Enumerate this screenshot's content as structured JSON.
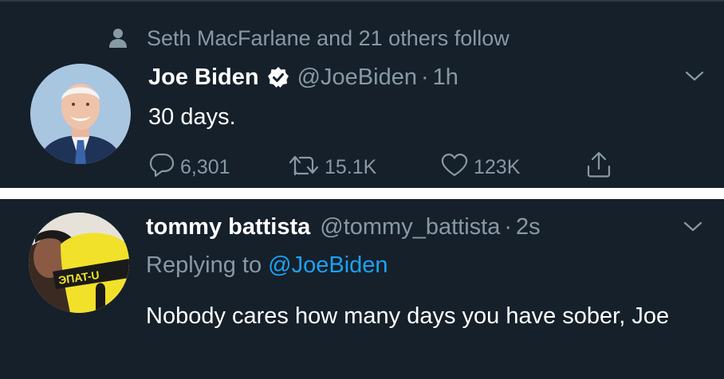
{
  "tweet1": {
    "context": "Seth MacFarlane and 21 others follow",
    "author_name": "Joe Biden",
    "verified": true,
    "handle": "@JoeBiden",
    "separator": "·",
    "time": "1h",
    "text": "30 days.",
    "replies": "6,301",
    "retweets": "15.1K",
    "likes": "123K"
  },
  "tweet2": {
    "author_name": "tommy battista",
    "handle": "@tommy_battista",
    "separator": "·",
    "time": "2s",
    "replying_prefix": "Replying to",
    "replying_to": "@JoeBiden",
    "text": "Nobody cares how many days you have sober, Joe"
  },
  "colors": {
    "background": "#15202b",
    "divider": "#ffffff",
    "secondary_text": "#8899a6",
    "accent": "#1da1f2",
    "primary_text": "#ffffff"
  },
  "icons": [
    "person-icon",
    "verified-badge-icon",
    "chevron-down-icon",
    "reply-icon",
    "retweet-icon",
    "like-icon",
    "share-icon"
  ]
}
